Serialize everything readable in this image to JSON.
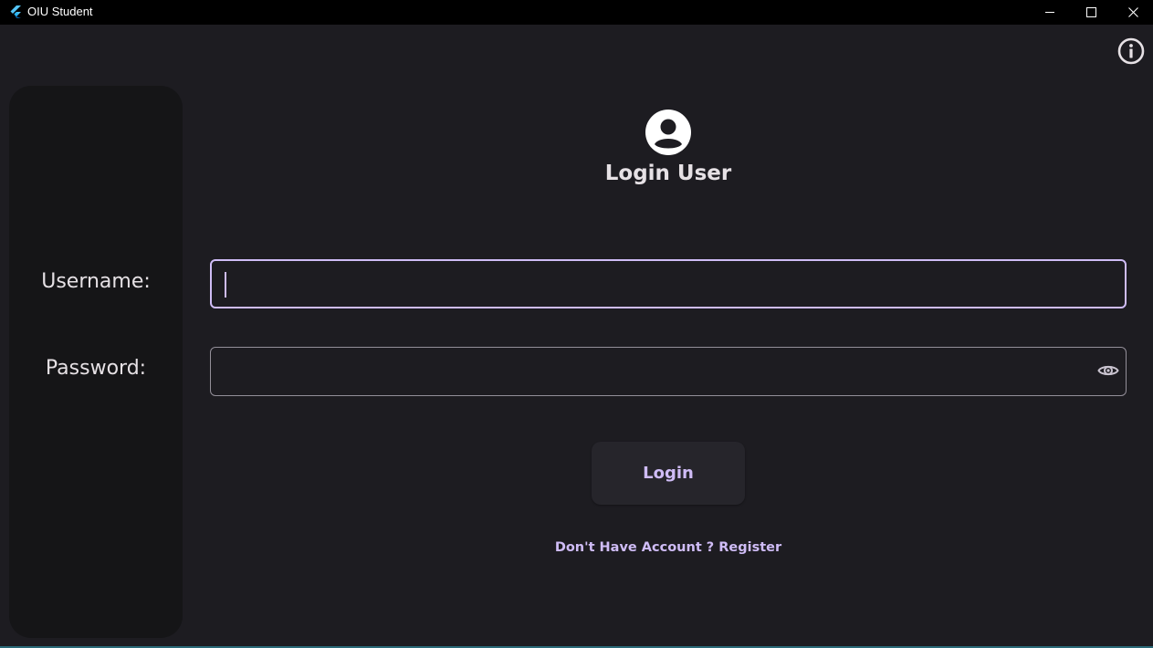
{
  "window": {
    "title": "OIU Student",
    "app_icon": "flutter-logo-icon",
    "controls": [
      "minimize-icon",
      "maximize-icon",
      "close-icon"
    ]
  },
  "header": {
    "info_icon": "info-icon"
  },
  "login": {
    "avatar_icon": "account-circle-icon",
    "title": "Login User",
    "username_label": "Username:",
    "password_label": "Password:",
    "username_value": "",
    "password_value": "",
    "password_visibility_icon": "eye-icon",
    "login_button_label": "Login",
    "register_link": "Don't Have Account ? Register"
  },
  "colors": {
    "background": "#1d1c21",
    "side_panel": "#151517",
    "accent": "#cfbcf6",
    "text": "#e6e1e5",
    "field_border": "#938f99",
    "button_bg": "#26252b"
  }
}
